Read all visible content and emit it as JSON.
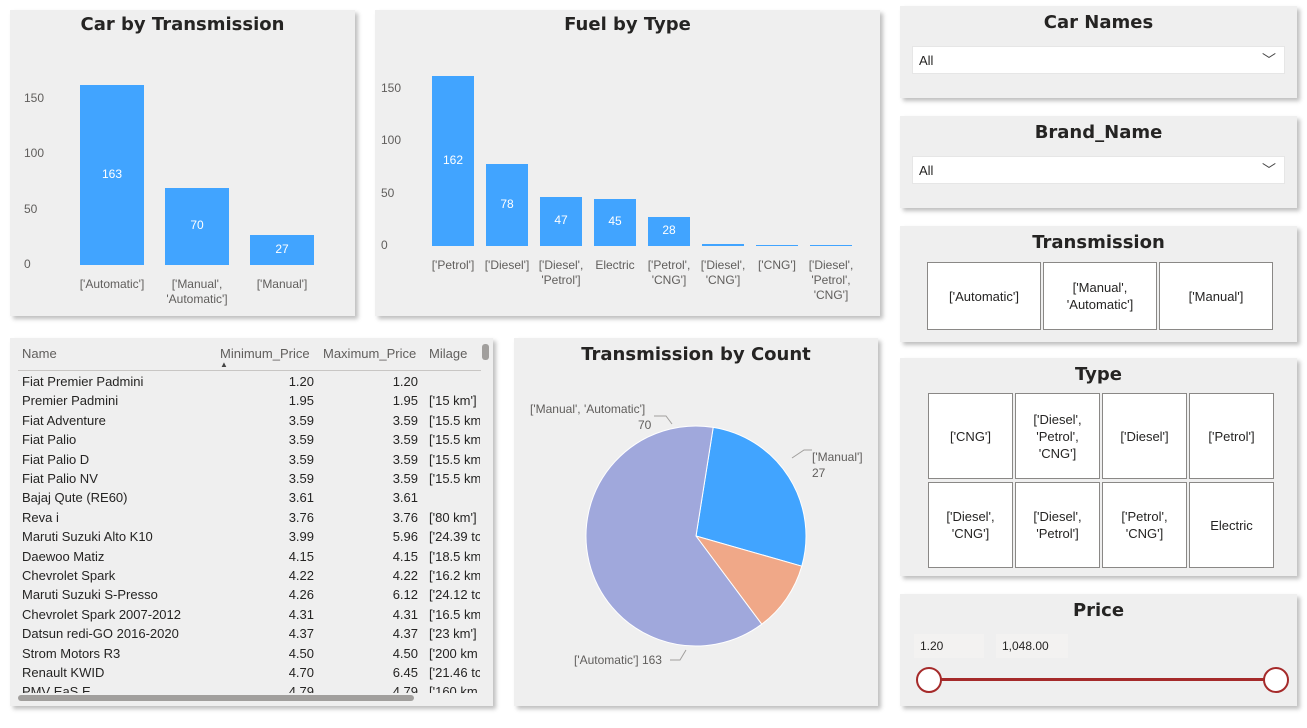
{
  "colors": {
    "bar": "#41a4ff",
    "pie_automatic": "#a0a8dc",
    "pie_manual_automatic": "#41a4ff",
    "pie_manual": "#f0a888",
    "slider": "#a52a2a"
  },
  "chart_data": [
    {
      "type": "bar",
      "title": "Car by Transmission",
      "categories": [
        [
          "['Automatic']"
        ],
        [
          "['Manual',",
          "'Automatic']"
        ],
        [
          "['Manual']"
        ]
      ],
      "values": [
        163,
        70,
        27
      ],
      "yticks": [
        "0",
        "50",
        "100",
        "150"
      ],
      "ylim": [
        0,
        170
      ]
    },
    {
      "type": "bar",
      "title": "Fuel by Type",
      "categories": [
        [
          "['Petrol']"
        ],
        [
          "['Diesel']"
        ],
        [
          "['Diesel',",
          "'Petrol']"
        ],
        [
          "Electric"
        ],
        [
          "['Petrol',",
          "'CNG']"
        ],
        [
          "['Diesel',",
          "'CNG']"
        ],
        [
          "['CNG']"
        ],
        [
          "['Diesel',",
          "'Petrol',",
          "'CNG']"
        ]
      ],
      "values": [
        162,
        78,
        47,
        45,
        28,
        2,
        1,
        1
      ],
      "labels": [
        "162",
        "78",
        "47",
        "45",
        "28",
        "",
        "",
        ""
      ],
      "yticks": [
        "0",
        "50",
        "100",
        "150"
      ],
      "ylim": [
        0,
        170
      ]
    },
    {
      "type": "pie",
      "title": "Transmission by Count",
      "slices": [
        {
          "name": "['Manual', 'Automatic']",
          "value": 70
        },
        {
          "name": "['Manual']",
          "value": 27
        },
        {
          "name": "['Automatic']",
          "value": 163
        }
      ]
    }
  ],
  "slicers": {
    "car_names": {
      "title": "Car Names",
      "value": "All"
    },
    "brand_name": {
      "title": "Brand_Name",
      "value": "All"
    },
    "transmission": {
      "title": "Transmission",
      "options": [
        [
          "['Automatic']"
        ],
        [
          "['Manual',",
          "'Automatic']"
        ],
        [
          "['Manual']"
        ]
      ]
    },
    "type": {
      "title": "Type",
      "options": [
        [
          "['CNG']"
        ],
        [
          "['Diesel',",
          "'Petrol',",
          "'CNG']"
        ],
        [
          "['Diesel']"
        ],
        [
          "['Petrol']"
        ],
        [
          "['Diesel',",
          "'CNG']"
        ],
        [
          "['Diesel',",
          "'Petrol']"
        ],
        [
          "['Petrol',",
          "'CNG']"
        ],
        [
          "Electric"
        ]
      ]
    },
    "price": {
      "title": "Price",
      "min": "1.20",
      "max": "1,048.00"
    }
  },
  "table": {
    "headers": [
      "Name",
      "Minimum_Price",
      "Maximum_Price",
      "Milage"
    ],
    "rows": [
      [
        "Fiat Premier Padmini",
        "1.20",
        "1.20",
        ""
      ],
      [
        "Premier Padmini",
        "1.95",
        "1.95",
        "['15 km']"
      ],
      [
        "Fiat Adventure",
        "3.59",
        "3.59",
        "['15.5 km"
      ],
      [
        "Fiat Palio",
        "3.59",
        "3.59",
        "['15.5 km"
      ],
      [
        "Fiat Palio D",
        "3.59",
        "3.59",
        "['15.5 km"
      ],
      [
        "Fiat Palio NV",
        "3.59",
        "3.59",
        "['15.5 km"
      ],
      [
        "Bajaj Qute (RE60)",
        "3.61",
        "3.61",
        ""
      ],
      [
        "Reva i",
        "3.76",
        "3.76",
        "['80 km']"
      ],
      [
        "Maruti Suzuki Alto K10",
        "3.99",
        "5.96",
        "['24.39 tc"
      ],
      [
        "Daewoo Matiz",
        "4.15",
        "4.15",
        "['18.5 km"
      ],
      [
        "Chevrolet Spark",
        "4.22",
        "4.22",
        "['16.2 km"
      ],
      [
        "Maruti Suzuki S-Presso",
        "4.26",
        "6.12",
        "['24.12 tc"
      ],
      [
        "Chevrolet Spark 2007-2012",
        "4.31",
        "4.31",
        "['16.5 km"
      ],
      [
        "Datsun redi-GO 2016-2020",
        "4.37",
        "4.37",
        "['23 km']"
      ],
      [
        "Strom Motors R3",
        "4.50",
        "4.50",
        "['200 km"
      ],
      [
        "Renault KWID",
        "4.70",
        "6.45",
        "['21.46 tc"
      ],
      [
        "PMV EaS E",
        "4.79",
        "4.79",
        "['160 km"
      ]
    ]
  }
}
